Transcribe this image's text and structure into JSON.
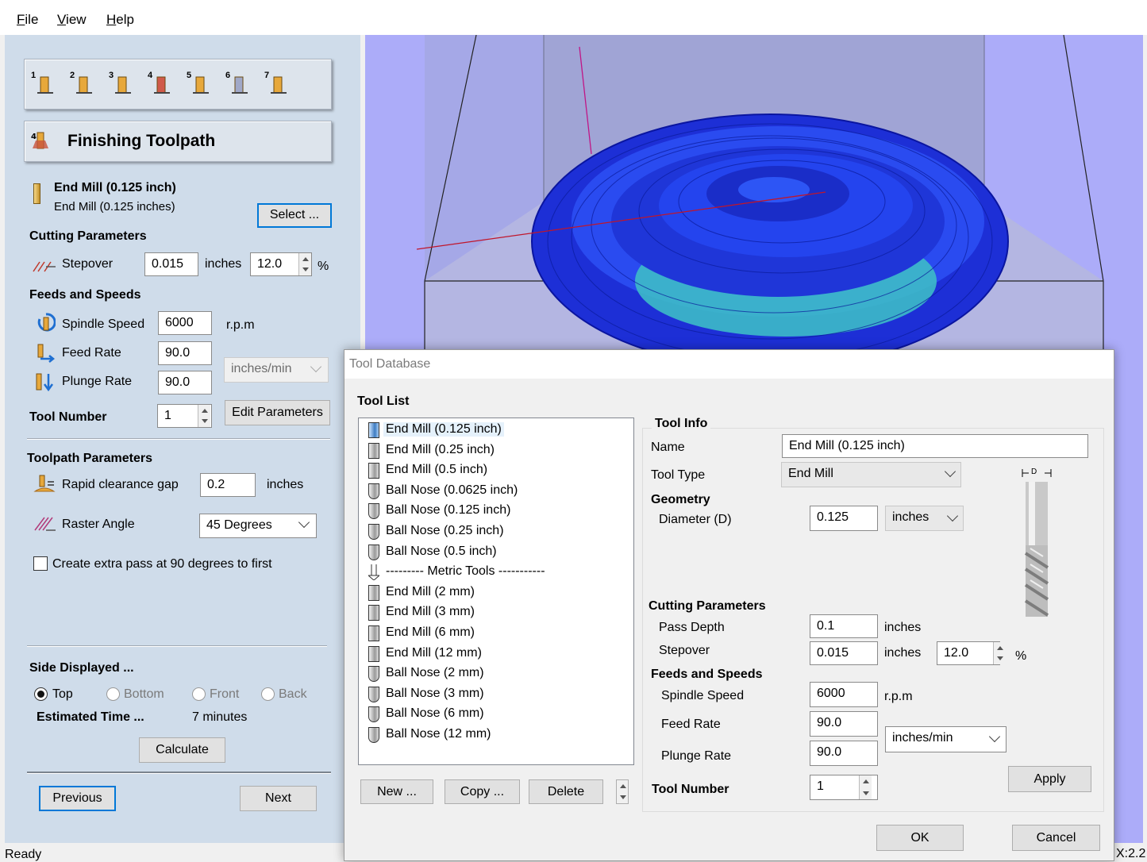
{
  "menubar": {
    "file": "File",
    "view": "View",
    "help": "Help"
  },
  "left": {
    "step_numbers": [
      "1",
      "2",
      "3",
      "4",
      "5",
      "6",
      "7"
    ],
    "header_title": "Finishing Toolpath",
    "tool_name_bold": "End Mill (0.125 inch)",
    "tool_name_sub": "End Mill (0.125 inches)",
    "select_button": "Select ...",
    "cutting_parameters": "Cutting Parameters",
    "stepover_label": "Stepover",
    "stepover_value": "0.015",
    "stepover_unit": "inches",
    "stepover_percent": "12.0",
    "percent_sign": "%",
    "feeds_speeds": "Feeds and Speeds",
    "spindle_label": "Spindle Speed",
    "spindle_value": "6000",
    "spindle_unit": "r.p.m",
    "feed_label": "Feed Rate",
    "feed_value": "90.0",
    "plunge_label": "Plunge Rate",
    "plunge_value": "90.0",
    "rate_unit": "inches/min",
    "tool_number_label": "Tool Number",
    "tool_number_value": "1",
    "edit_params_button": "Edit Parameters",
    "toolpath_params": "Toolpath Parameters",
    "rapid_label": "Rapid clearance gap",
    "rapid_value": "0.2",
    "rapid_unit": "inches",
    "raster_label": "Raster Angle",
    "raster_value": "45 Degrees",
    "extra_pass_label": "Create extra pass at 90 degrees to first",
    "side_displayed": "Side Displayed ...",
    "side_top": "Top",
    "side_bottom": "Bottom",
    "side_front": "Front",
    "side_back": "Back",
    "estimated_time_label": "Estimated Time ...",
    "estimated_time_value": "7 minutes",
    "calculate_button": "Calculate",
    "previous_button": "Previous",
    "next_button": "Next"
  },
  "status": {
    "text": "Ready",
    "coords": "X:2.2"
  },
  "dialog": {
    "title": "Tool Database",
    "tool_list_label": "Tool List",
    "tools": [
      {
        "name": "End Mill (0.125 inch)",
        "icon": "end-mill-icon",
        "selected": true
      },
      {
        "name": "End Mill (0.25 inch)",
        "icon": "end-mill-icon"
      },
      {
        "name": "End Mill (0.5 inch)",
        "icon": "end-mill-icon"
      },
      {
        "name": "Ball Nose (0.0625 inch)",
        "icon": "ball-nose-icon"
      },
      {
        "name": "Ball Nose (0.125 inch)",
        "icon": "ball-nose-icon"
      },
      {
        "name": "Ball Nose (0.25 inch)",
        "icon": "ball-nose-icon"
      },
      {
        "name": "Ball Nose (0.5 inch)",
        "icon": "ball-nose-icon"
      },
      {
        "name": "--------- Metric Tools -----------",
        "icon": "group-icon"
      },
      {
        "name": "End Mill (2 mm)",
        "icon": "end-mill-icon"
      },
      {
        "name": "End Mill (3 mm)",
        "icon": "end-mill-icon"
      },
      {
        "name": "End Mill (6 mm)",
        "icon": "end-mill-icon"
      },
      {
        "name": "End Mill (12 mm)",
        "icon": "end-mill-icon"
      },
      {
        "name": "Ball Nose (2 mm)",
        "icon": "ball-nose-icon"
      },
      {
        "name": "Ball Nose (3 mm)",
        "icon": "ball-nose-icon"
      },
      {
        "name": "Ball Nose (6 mm)",
        "icon": "ball-nose-icon"
      },
      {
        "name": "Ball Nose (12 mm)",
        "icon": "ball-nose-icon"
      }
    ],
    "new_button": "New ...",
    "copy_button": "Copy ...",
    "delete_button": "Delete",
    "tool_info_label": "Tool Info",
    "name_label": "Name",
    "name_value": "End Mill (0.125 inch)",
    "tool_type_label": "Tool Type",
    "tool_type_value": "End Mill",
    "geometry_label": "Geometry",
    "diameter_label": "Diameter (D)",
    "diameter_value": "0.125",
    "diameter_unit": "inches",
    "diagram_label": "D",
    "cutting_params_label": "Cutting Parameters",
    "pass_depth_label": "Pass Depth",
    "pass_depth_value": "0.1",
    "pass_depth_unit": "inches",
    "stepover_label": "Stepover",
    "stepover_value": "0.015",
    "stepover_unit": "inches",
    "stepover_percent": "12.0",
    "percent_sign": "%",
    "feeds_label": "Feeds and Speeds",
    "spindle_label": "Spindle Speed",
    "spindle_value": "6000",
    "spindle_unit": "r.p.m",
    "feed_label": "Feed Rate",
    "feed_value": "90.0",
    "plunge_label": "Plunge Rate",
    "plunge_value": "90.0",
    "rate_unit": "inches/min",
    "tool_number_label": "Tool Number",
    "tool_number_value": "1",
    "apply_button": "Apply",
    "ok_button": "OK",
    "cancel_button": "Cancel"
  }
}
